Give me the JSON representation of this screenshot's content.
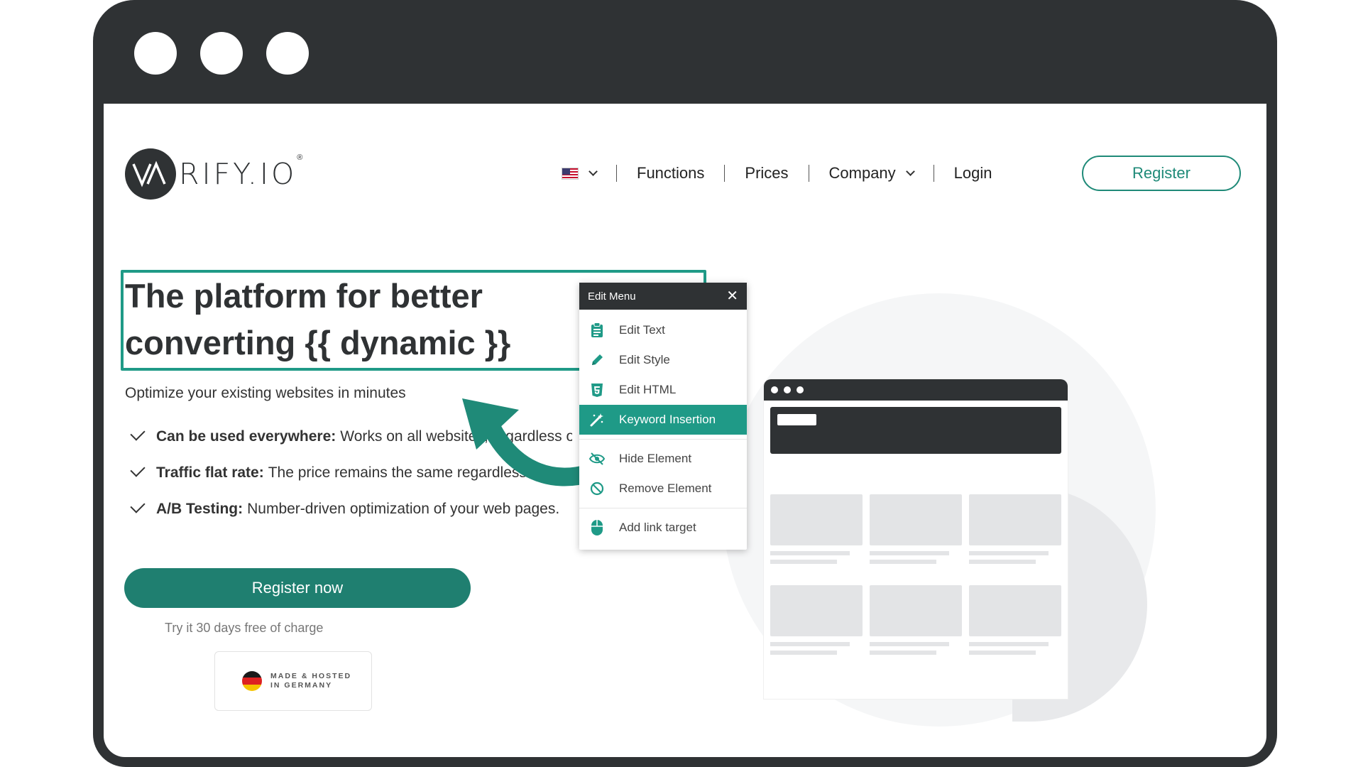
{
  "nav": {
    "language_icon": "us-flag-icon",
    "links": [
      "Functions",
      "Prices",
      "Company",
      "Login"
    ],
    "register_label": "Register"
  },
  "logo": {
    "text": "RIFY.IO",
    "mark": "VA",
    "reg": "®"
  },
  "hero": {
    "title_line1": "The platform for better",
    "title_line2": "converting {{ dynamic }}",
    "subtitle": "Optimize your existing websites in minutes",
    "features": [
      {
        "bold": "Can be used everywhere:",
        "text": "Works on all websites, regardless of the system used."
      },
      {
        "bold": "Traffic flat rate:",
        "text": "The price remains the same regardless of your traffic."
      },
      {
        "bold": "A/B Testing:",
        "text": "Number-driven optimization of your web pages."
      }
    ],
    "cta_label": "Register now",
    "trial_text": "Try it 30 days free of charge",
    "badge_line1": "MADE & HOSTED",
    "badge_line2": "IN GERMANY"
  },
  "edit_menu": {
    "title": "Edit Menu",
    "close": "✕",
    "items": [
      {
        "label": "Edit Text",
        "icon": "clipboard-list-icon"
      },
      {
        "label": "Edit Style",
        "icon": "pencil-icon"
      },
      {
        "label": "Edit HTML",
        "icon": "html5-icon"
      },
      {
        "label": "Keyword Insertion",
        "icon": "magic-wand-icon",
        "active": true
      },
      {
        "label": "Hide Element",
        "icon": "eye-slash-icon"
      },
      {
        "label": "Remove Element",
        "icon": "ban-icon"
      },
      {
        "label": "Add link target",
        "icon": "mouse-icon"
      }
    ]
  },
  "colors": {
    "accent": "#1f9a87",
    "cta": "#1f7f70",
    "dark": "#2f3234"
  }
}
